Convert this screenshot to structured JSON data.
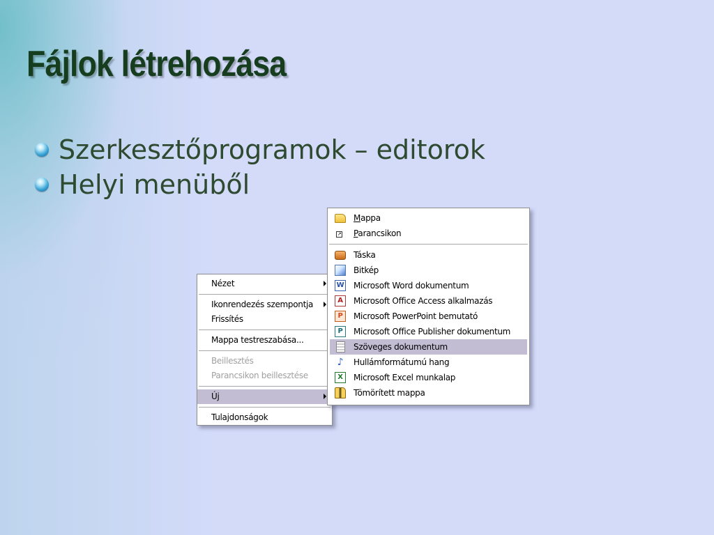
{
  "slide": {
    "title": "Fájlok létrehozása",
    "bullets": [
      {
        "text": "Szerkesztőprogramok – editorok"
      },
      {
        "text": "Helyi menüből"
      }
    ]
  },
  "context_menu": {
    "items": [
      {
        "label": "Nézet"
      },
      {
        "label": "Ikonrendezés szempontja"
      },
      {
        "label": "Frissítés"
      },
      {
        "label": "Mappa testreszabása..."
      },
      {
        "label": "Beillesztés"
      },
      {
        "label": "Parancsikon beillesztése"
      },
      {
        "label": "Új"
      },
      {
        "label": "Tulajdonságok"
      }
    ]
  },
  "new_submenu": {
    "items": [
      {
        "underline": "M",
        "rest": "appa",
        "icon": "folder-icon"
      },
      {
        "underline": "P",
        "rest": "arancsikon",
        "icon": "shortcut-icon"
      },
      {
        "label": "Táska",
        "icon": "briefcase-icon"
      },
      {
        "label": "Bitkép",
        "icon": "bitmap-icon"
      },
      {
        "label": "Microsoft Word dokumentum",
        "icon": "word-document-icon"
      },
      {
        "label": "Microsoft Office Access alkalmazás",
        "icon": "access-application-icon"
      },
      {
        "label": "Microsoft PowerPoint bemutató",
        "icon": "powerpoint-presentation-icon"
      },
      {
        "label": "Microsoft Office Publisher dokumentum",
        "icon": "publisher-document-icon"
      },
      {
        "label": "Szöveges dokumentum",
        "icon": "text-document-icon"
      },
      {
        "label": "Hullámformátumú hang",
        "icon": "wave-sound-icon"
      },
      {
        "label": "Microsoft Excel munkalap",
        "icon": "excel-worksheet-icon"
      },
      {
        "label": "Tömörített mappa",
        "icon": "compressed-folder-icon"
      }
    ]
  },
  "colors": {
    "background": "#d3dbf9",
    "title": "#173d1f",
    "bullet_text": "#2e4a30",
    "menu_highlight": "#c3bdd4",
    "disabled_text": "#a0a0a0"
  }
}
